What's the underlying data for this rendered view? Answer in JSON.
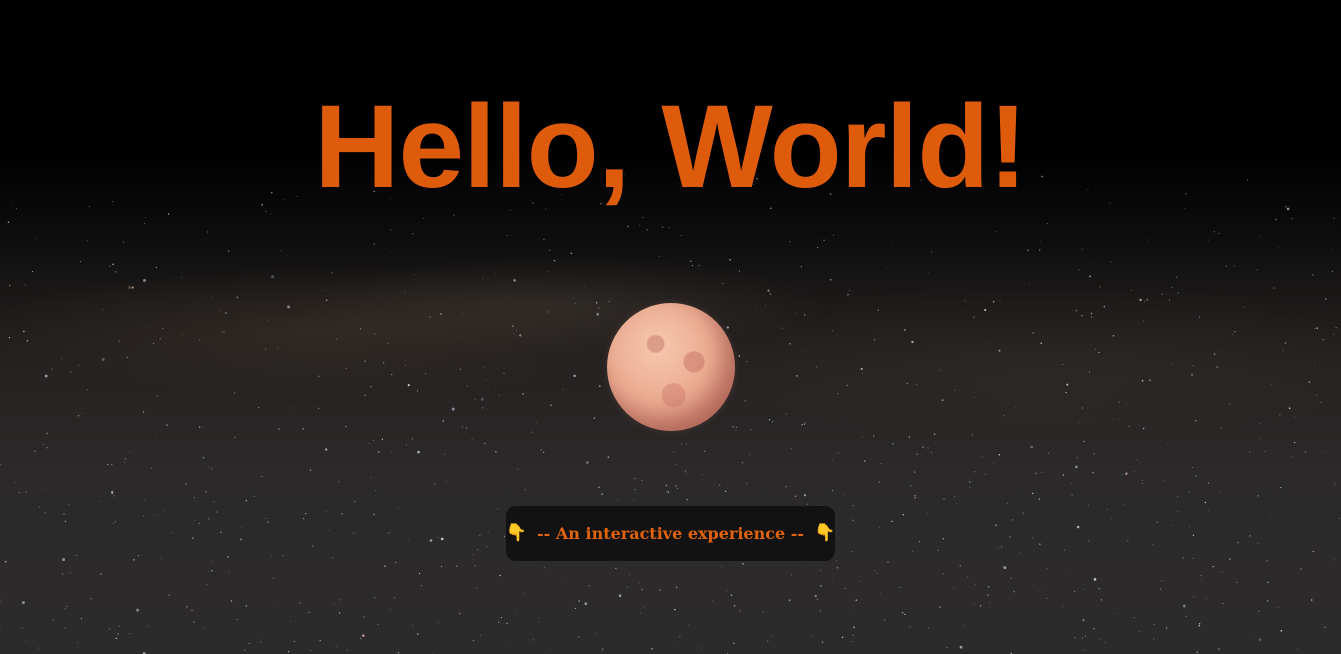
{
  "hero": {
    "title": "Hello, World!"
  },
  "planet": {
    "icon": "planet-sphere"
  },
  "cta": {
    "icon_left": "👇",
    "label": "-- An interactive experience --",
    "icon_right": "👇"
  },
  "colors": {
    "accent": "#df5b0c",
    "cta_text": "#e0630f",
    "cta_background": "#121212",
    "planet": "#ecad92",
    "background_top": "#000000",
    "background_bottom": "#2c2b2b"
  }
}
